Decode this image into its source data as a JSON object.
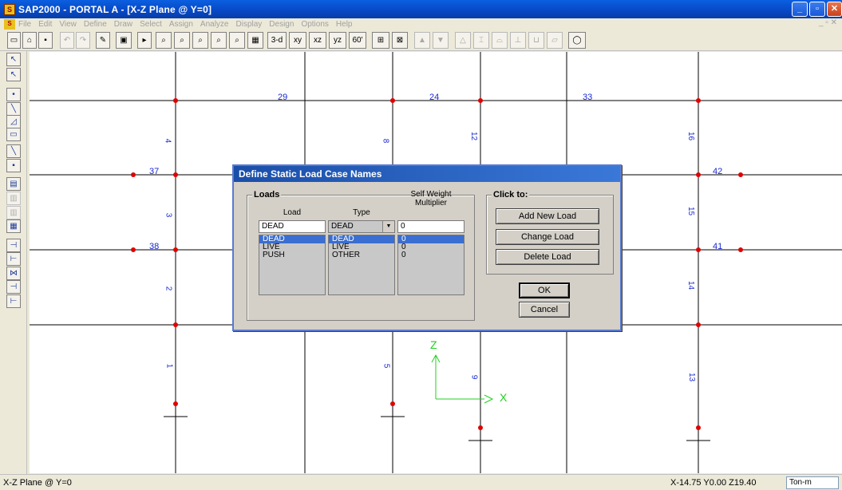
{
  "window": {
    "title": "SAP2000 - PORTAL A - [X-Z Plane @ Y=0]"
  },
  "menu": [
    "File",
    "Edit",
    "View",
    "Define",
    "Draw",
    "Select",
    "Assign",
    "Analyze",
    "Display",
    "Design",
    "Options",
    "Help"
  ],
  "toolbar": {
    "view_3d": "3-d",
    "view_xy": "xy",
    "view_xz": "xz",
    "view_yz": "yz",
    "view_persp": "60'"
  },
  "canvas": {
    "frame_labels": [
      "29",
      "24",
      "33",
      "4",
      "8",
      "12",
      "16",
      "37",
      "42",
      "3",
      "15",
      "38",
      "41",
      "2",
      "14",
      "1",
      "5",
      "9",
      "13"
    ],
    "axis_z": "Z",
    "axis_x": "X"
  },
  "dialog": {
    "title": "Define Static Load Case Names",
    "loads_group": "Loads",
    "col_load": "Load",
    "col_type": "Type",
    "col_multiplier": "Self Weight Multiplier",
    "load_input": "DEAD",
    "type_select": "DEAD",
    "multiplier_input": "0",
    "rows": [
      {
        "load": "DEAD",
        "type": "DEAD",
        "mult": "0"
      },
      {
        "load": "LIVE",
        "type": "LIVE",
        "mult": "0"
      },
      {
        "load": "PUSH",
        "type": "OTHER",
        "mult": "0"
      }
    ],
    "click_group": "Click to:",
    "add_label": "Add New Load",
    "change_label": "Change Load",
    "delete_label": "Delete Load",
    "ok_label": "OK",
    "cancel_label": "Cancel"
  },
  "status": {
    "left": "X-Z Plane @ Y=0",
    "coords": "X-14.75 Y0.00 Z19.40",
    "units": "Ton-m"
  }
}
